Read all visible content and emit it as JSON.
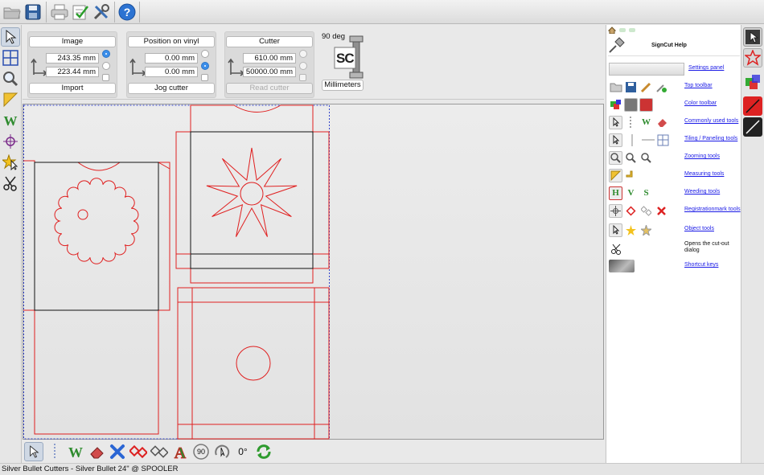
{
  "top_toolbar": {
    "icons": [
      "open-folder-icon",
      "save-icon",
      "print-icon",
      "checklist-icon",
      "tools-icon",
      "help-icon"
    ]
  },
  "left_toolbar": {
    "icons": [
      "pointer-icon",
      "tiling-icon",
      "zoom-icon",
      "measure-icon",
      "weed-icon",
      "registration-mark-icon",
      "object-star-icon",
      "scissors-icon"
    ]
  },
  "settings": {
    "image": {
      "title": "Image",
      "width": "243.35 mm",
      "height": "223.44 mm",
      "import_label": "Import"
    },
    "position": {
      "title": "Position on vinyl",
      "x": "0.00 mm",
      "y": "0.00 mm",
      "jog_label": "Jog cutter"
    },
    "cutter": {
      "title": "Cutter",
      "width": "610.00 mm",
      "length": "50000.00 mm",
      "read_label": "Read cutter"
    },
    "rotation_label": "90 deg",
    "units_label": "Millimeters",
    "logo_text": "SC"
  },
  "help": {
    "title": "SignCut Help",
    "items": [
      {
        "label": "Settings panel",
        "link": true
      },
      {
        "label": "Top toolbar",
        "link": true
      },
      {
        "label": "Color toolbar",
        "link": true
      },
      {
        "label": "Commonly used tools",
        "link": true
      },
      {
        "label": "Tiling / Paneling tools",
        "link": true
      },
      {
        "label": "Zooming tools",
        "link": true
      },
      {
        "label": "Measuring tools",
        "link": true
      },
      {
        "label": "Weeding tools",
        "link": true
      },
      {
        "label": "Registrationmark tools",
        "link": true
      },
      {
        "label": "Object tools",
        "link": true
      },
      {
        "label": "Opens the cut-out dialog",
        "link": false
      },
      {
        "label": "Shortcut keys",
        "link": true
      }
    ],
    "weed_letters": [
      "H",
      "V",
      "S"
    ]
  },
  "bottom_toolbar": {
    "rotate_90_label": "90",
    "rotate_0_label": "0°"
  },
  "status": {
    "text": "Silver Bullet Cutters - Silver Bullet 24\" @ SPOOLER"
  },
  "colors": {
    "cut_line": "#e02020",
    "outline": "#111111",
    "selection": "#3344cc",
    "link": "#1a1ae6"
  }
}
